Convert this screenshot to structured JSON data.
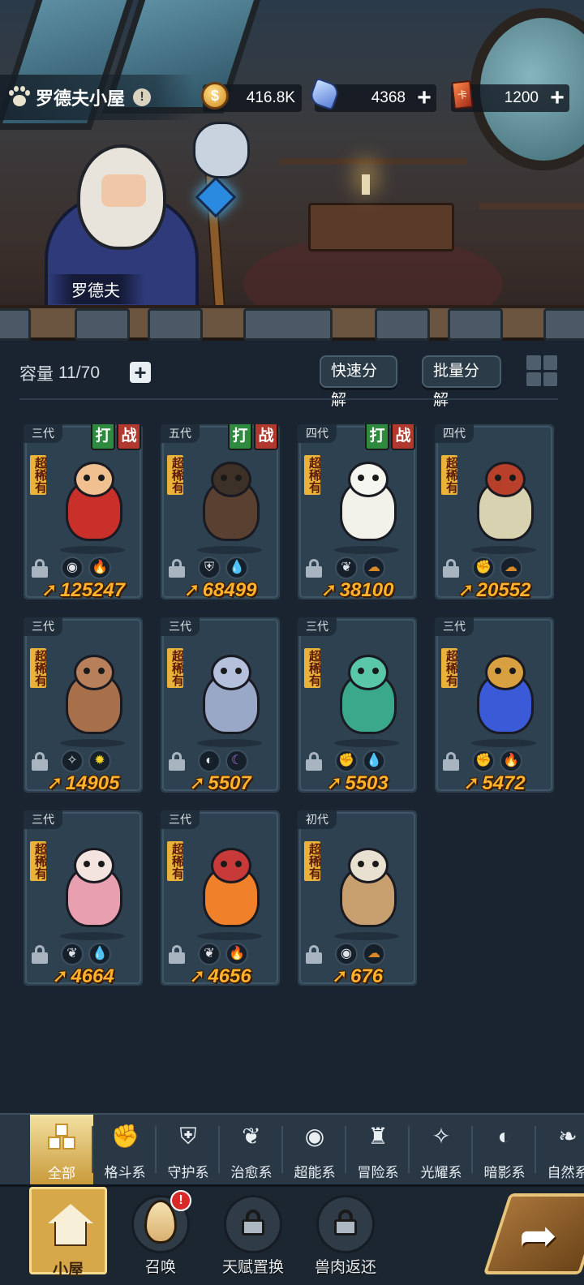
{
  "header": {
    "title": "罗德夫小屋",
    "info_glyph": "!",
    "npc_name": "罗德夫"
  },
  "resources": [
    {
      "icon": "gold-coin-icon",
      "value": "416.8K",
      "has_plus": false
    },
    {
      "icon": "crystal-gem-icon",
      "value": "4368",
      "has_plus": true
    },
    {
      "icon": "summon-card-icon",
      "value": "1200",
      "has_plus": true
    }
  ],
  "toolbar": {
    "capacity_label": "容量",
    "capacity_value": "11/70",
    "fast_decompose": "快速分解",
    "batch_decompose": "批量分解"
  },
  "tag_labels": {
    "fight": "打",
    "battle": "战",
    "rarity": "超稀有"
  },
  "pets": [
    {
      "generation": "三代",
      "power": "125247",
      "tags": true,
      "elements": [
        "alien-icon",
        "fire-icon"
      ],
      "body_color": "#c9302a",
      "head_color": "#f0c090"
    },
    {
      "generation": "五代",
      "power": "68499",
      "tags": true,
      "elements": [
        "shield-icon",
        "water-drop-icon"
      ],
      "body_color": "#5a4030",
      "head_color": "#3d3026"
    },
    {
      "generation": "四代",
      "power": "38100",
      "tags": true,
      "elements": [
        "sprout-icon",
        "earth-icon"
      ],
      "body_color": "#f2f2ea",
      "head_color": "#f6f6f0"
    },
    {
      "generation": "四代",
      "power": "20552",
      "tags": false,
      "elements": [
        "fist-icon",
        "earth-icon"
      ],
      "body_color": "#d8d2b0",
      "head_color": "#b8402a"
    },
    {
      "generation": "三代",
      "power": "14905",
      "tags": false,
      "elements": [
        "crosshair-star-icon",
        "sun-icon"
      ],
      "body_color": "#a8704a",
      "head_color": "#b8805a"
    },
    {
      "generation": "三代",
      "power": "5507",
      "tags": false,
      "elements": [
        "eclipse-icon",
        "moon-icon"
      ],
      "body_color": "#9aa8c8",
      "head_color": "#b4c0dc"
    },
    {
      "generation": "三代",
      "power": "5503",
      "tags": false,
      "elements": [
        "fist-icon",
        "water-drop-icon"
      ],
      "body_color": "#3aa88a",
      "head_color": "#5ac8a8"
    },
    {
      "generation": "三代",
      "power": "5472",
      "tags": false,
      "elements": [
        "fist-icon",
        "fire-icon"
      ],
      "body_color": "#3a5ad8",
      "head_color": "#d8a040"
    },
    {
      "generation": "三代",
      "power": "4664",
      "tags": false,
      "elements": [
        "sprout-icon",
        "water-drop-icon"
      ],
      "body_color": "#e8a0b0",
      "head_color": "#f4e4e0"
    },
    {
      "generation": "三代",
      "power": "4656",
      "tags": false,
      "elements": [
        "sprout-icon",
        "fire-icon"
      ],
      "body_color": "#f0802a",
      "head_color": "#c83a3a"
    },
    {
      "generation": "初代",
      "power": "676",
      "tags": false,
      "elements": [
        "alien-icon",
        "earth-icon"
      ],
      "body_color": "#c8a070",
      "head_color": "#e8e0d0"
    }
  ],
  "categories": [
    {
      "label": "全部",
      "icon": "all-boxes-icon",
      "glyph": "",
      "active": true
    },
    {
      "label": "格斗系",
      "icon": "fist-icon",
      "glyph": "✊",
      "active": false
    },
    {
      "label": "守护系",
      "icon": "shield-icon",
      "glyph": "⛨",
      "active": false
    },
    {
      "label": "治愈系",
      "icon": "sprout-icon",
      "glyph": "❦",
      "active": false
    },
    {
      "label": "超能系",
      "icon": "alien-icon",
      "glyph": "◉",
      "active": false
    },
    {
      "label": "冒险系",
      "icon": "lantern-icon",
      "glyph": "♜",
      "active": false
    },
    {
      "label": "光耀系",
      "icon": "crosshair-star-icon",
      "glyph": "✧",
      "active": false
    },
    {
      "label": "暗影系",
      "icon": "eclipse-icon",
      "glyph": "◐",
      "active": false
    },
    {
      "label": "自然系",
      "icon": "leaf-icon",
      "glyph": "❧",
      "active": false
    }
  ],
  "bottom_nav": [
    {
      "label": "小屋",
      "icon": "house-icon",
      "active": true,
      "locked": false,
      "badge": ""
    },
    {
      "label": "召唤",
      "icon": "egg-icon",
      "active": false,
      "locked": false,
      "badge": "!"
    },
    {
      "label": "天赋置换",
      "icon": "lock-icon",
      "active": false,
      "locked": true,
      "badge": ""
    },
    {
      "label": "兽肉返还",
      "icon": "lock-icon",
      "active": false,
      "locked": true,
      "badge": ""
    }
  ],
  "go_button": {
    "icon": "forward-arrow-icon",
    "glyph": "➦"
  },
  "colors": {
    "power": "#ffb22b",
    "card_bg": "#2d4150",
    "rarity_bg": "#e9b23a",
    "active_tab": "#d7a84a"
  },
  "element_glyphs": {
    "alien-icon": "◉",
    "fire-icon": "🔥",
    "shield-icon": "⛨",
    "water-drop-icon": "💧",
    "sprout-icon": "❦",
    "earth-icon": "☁",
    "fist-icon": "✊",
    "crosshair-star-icon": "✧",
    "sun-icon": "✹",
    "eclipse-icon": "◐",
    "moon-icon": "☾"
  },
  "element_colors": {
    "alien-icon": "#e0e4e8",
    "fire-icon": "#e84a2a",
    "shield-icon": "#e0e4e8",
    "water-drop-icon": "#3ab0e8",
    "sprout-icon": "#e0e4e8",
    "earth-icon": "#d8892a",
    "fist-icon": "#e0e4e8",
    "crosshair-star-icon": "#e0e4e8",
    "sun-icon": "#f2d22a",
    "eclipse-icon": "#e0e4e8",
    "moon-icon": "#b070e0"
  }
}
